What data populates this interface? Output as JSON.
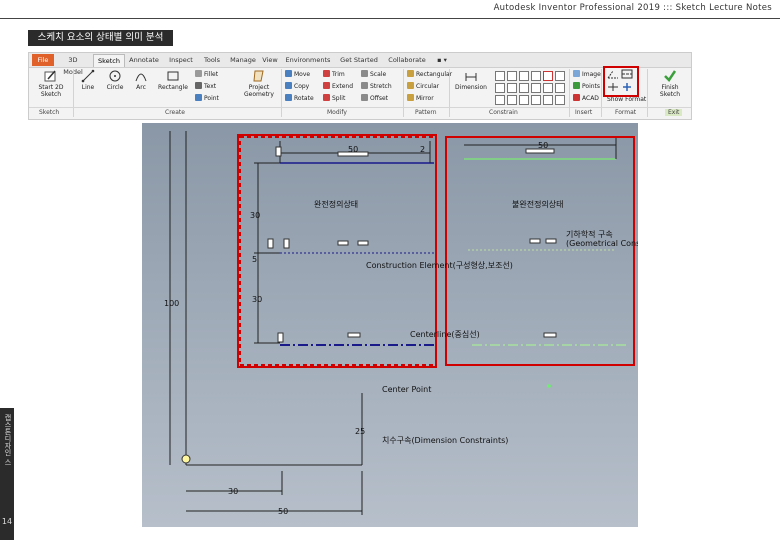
{
  "header": {
    "title": "Autodesk Inventor Professional 2019 ::: Sketch Lecture Notes"
  },
  "section_badge": "스케치 요소의 상태별 의미 분석",
  "side": {
    "vertical_text": "캡스톤디자인 스",
    "page_number": "14"
  },
  "ribbon": {
    "tabs": [
      "File",
      "3D Model",
      "Sketch",
      "Annotate",
      "Inspect",
      "Tools",
      "Manage",
      "View",
      "Environments",
      "Get Started",
      "Collaborate",
      "▪ ▾"
    ],
    "buttons": {
      "start_sketch": "Start 2D Sketch",
      "line": "Line",
      "circle": "Circle",
      "arc": "Arc",
      "rectangle": "Rectangle",
      "fillet": "Fillet",
      "text": "Text",
      "point": "Point",
      "project_geometry": "Project Geometry",
      "move": "Move",
      "copy": "Copy",
      "rotate": "Rotate",
      "trim": "Trim",
      "extend": "Extend",
      "split": "Split",
      "scale": "Scale",
      "stretch": "Stretch",
      "offset": "Offset",
      "rect_pattern": "Rectangular",
      "circular": "Circular",
      "mirror": "Mirror",
      "dimension": "Dimension",
      "image": "Image",
      "points": "Points",
      "acad": "ACAD",
      "show_format": "Show Format",
      "finish_sketch": "Finish Sketch"
    },
    "groups": [
      "Sketch",
      "Create",
      "Modify",
      "Pattern",
      "Constrain",
      "Insert",
      "Format",
      "Exit"
    ]
  },
  "canvas": {
    "label_full": "완전정의상태",
    "label_partial": "불완전정의상태",
    "label_geo": "기하학적 구속",
    "label_geo_en": "(Geometrical Constraint)",
    "label_construction": "Construction Element(구성형상,보조선)",
    "label_centerline": "Centerline(중심선)",
    "label_centerpoint": "Center Point",
    "label_dimension": "치수구속(Dimension Constraints)",
    "dims": {
      "d50a": "50",
      "d50b": "50",
      "d30a": "30",
      "d5": "5",
      "d30b": "30",
      "d100": "100",
      "d25": "25",
      "d30c": "30",
      "d50c": "50",
      "d2": "2"
    }
  },
  "colors": {
    "highlight_red": "#d00000",
    "dark_blue_line": "#1a1a8a",
    "green_line": "#7fe07f",
    "file_tab": "#e0612a"
  }
}
